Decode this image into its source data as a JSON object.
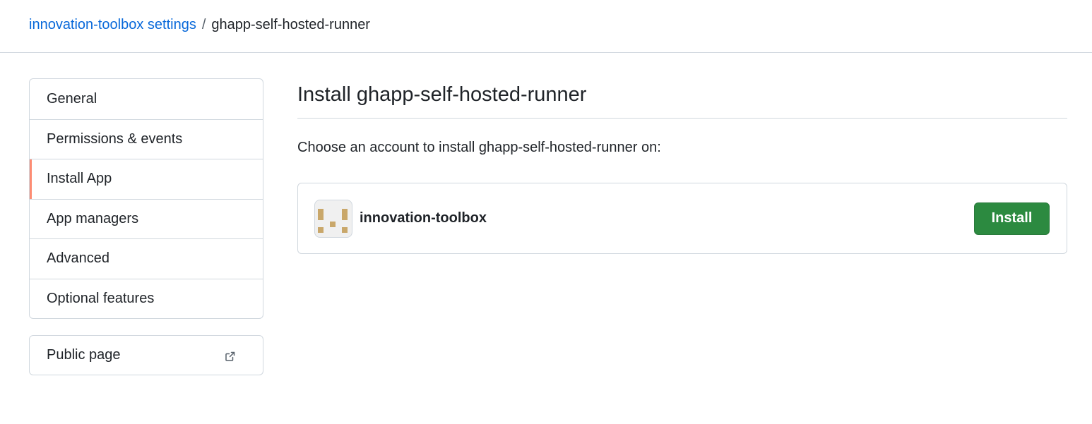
{
  "breadcrumb": {
    "parent_label": "innovation-toolbox settings",
    "separator": "/",
    "current": "ghapp-self-hosted-runner"
  },
  "sidebar": {
    "items": [
      {
        "label": "General",
        "selected": false
      },
      {
        "label": "Permissions & events",
        "selected": false
      },
      {
        "label": "Install App",
        "selected": true
      },
      {
        "label": "App managers",
        "selected": false
      },
      {
        "label": "Advanced",
        "selected": false
      },
      {
        "label": "Optional features",
        "selected": false
      }
    ],
    "public_page": {
      "label": "Public page",
      "icon": "external-link-icon"
    }
  },
  "main": {
    "title": "Install ghapp-self-hosted-runner",
    "description": "Choose an account to install ghapp-self-hosted-runner on:",
    "account": {
      "name": "innovation-toolbox",
      "install_label": "Install"
    }
  },
  "colors": {
    "link": "#0969da",
    "selected_accent": "#fd8c73",
    "install_button": "#2c8a40",
    "avatar_pattern": "#c9a76a"
  }
}
